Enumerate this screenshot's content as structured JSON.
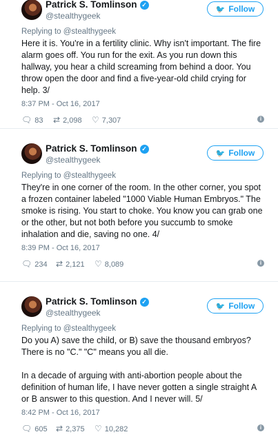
{
  "tweets": [
    {
      "author": "Patrick S. Tomlinson",
      "handle": "@stealthygeek",
      "follow_label": "Follow",
      "replying_prefix": "Replying to",
      "replying_handle": "@stealthygeek",
      "text": "Here it is. You're in a fertility clinic. Why isn't important. The fire alarm goes off. You run for the exit. As you run down this hallway, you hear a child screaming from behind a door. You throw open the door and find a five-year-old child crying for help. 3/",
      "time": "8:37 PM - Oct 16, 2017",
      "replies": "83",
      "retweets": "2,098",
      "likes": "7,307"
    },
    {
      "author": "Patrick S. Tomlinson",
      "handle": "@stealthygeek",
      "follow_label": "Follow",
      "replying_prefix": "Replying to",
      "replying_handle": "@stealthygeek",
      "text": "They're in one corner of the room. In the other corner, you spot a frozen container labeled \"1000 Viable Human Embryos.\" The smoke is rising. You start to choke. You know you can grab one or the other, but not both before you succumb to smoke inhalation and die, saving no one. 4/",
      "time": "8:39 PM - Oct 16, 2017",
      "replies": "234",
      "retweets": "2,121",
      "likes": "8,089"
    },
    {
      "author": "Patrick S. Tomlinson",
      "handle": "@stealthygeek",
      "follow_label": "Follow",
      "replying_prefix": "Replying to",
      "replying_handle": "@stealthygeek",
      "text": "Do you A) save the child, or B) save the thousand embryos? There is no \"C.\" \"C\" means you all die.\n\nIn a decade of arguing with anti-abortion people about the definition of human life, I have never gotten a single straight A or B answer to this question. And I never will. 5/",
      "time": "8:42 PM - Oct 16, 2017",
      "replies": "605",
      "retweets": "2,375",
      "likes": "10,282"
    }
  ],
  "icons": {
    "verified": "verified-badge-icon",
    "reply": "reply-icon",
    "retweet": "retweet-icon",
    "like": "heart-icon",
    "info": "info-icon",
    "bird": "twitter-bird-icon"
  },
  "colors": {
    "accent": "#1da1f2",
    "text": "#14171a",
    "muted": "#657786"
  }
}
